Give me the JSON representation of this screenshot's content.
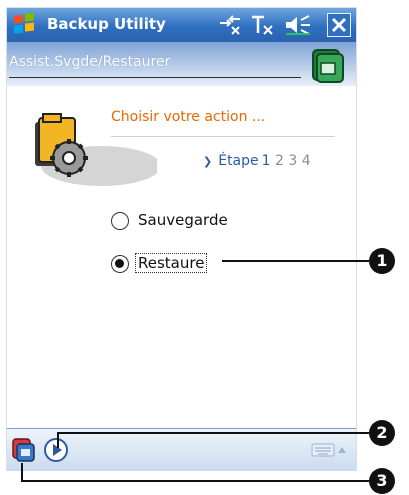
{
  "window": {
    "title": "Backup Utility"
  },
  "header": {
    "title": "Assist.Svgde/Restaurer"
  },
  "content": {
    "action_title": "Choisir votre action ...",
    "step_label": "Étape",
    "step_current": "1",
    "steps_remaining": "2 3 4",
    "options": [
      {
        "label": "Sauvegarde",
        "selected": false
      },
      {
        "label": "Restaure",
        "selected": true
      }
    ]
  },
  "callouts": [
    "1",
    "2",
    "3"
  ],
  "icons": {
    "start": "windows-start-icon",
    "connectivity": "connectivity-icon",
    "signal": "signal-off-icon",
    "volume": "speaker-icon",
    "close": "close-icon",
    "app": "backup-app-icon",
    "wizard": "folder-gear-icon",
    "play": "play-icon",
    "keyboard": "keyboard-icon"
  },
  "colors": {
    "titlebar": "#2f6fc0",
    "accent_orange": "#e56a00",
    "step_blue": "#2f5aa0"
  }
}
